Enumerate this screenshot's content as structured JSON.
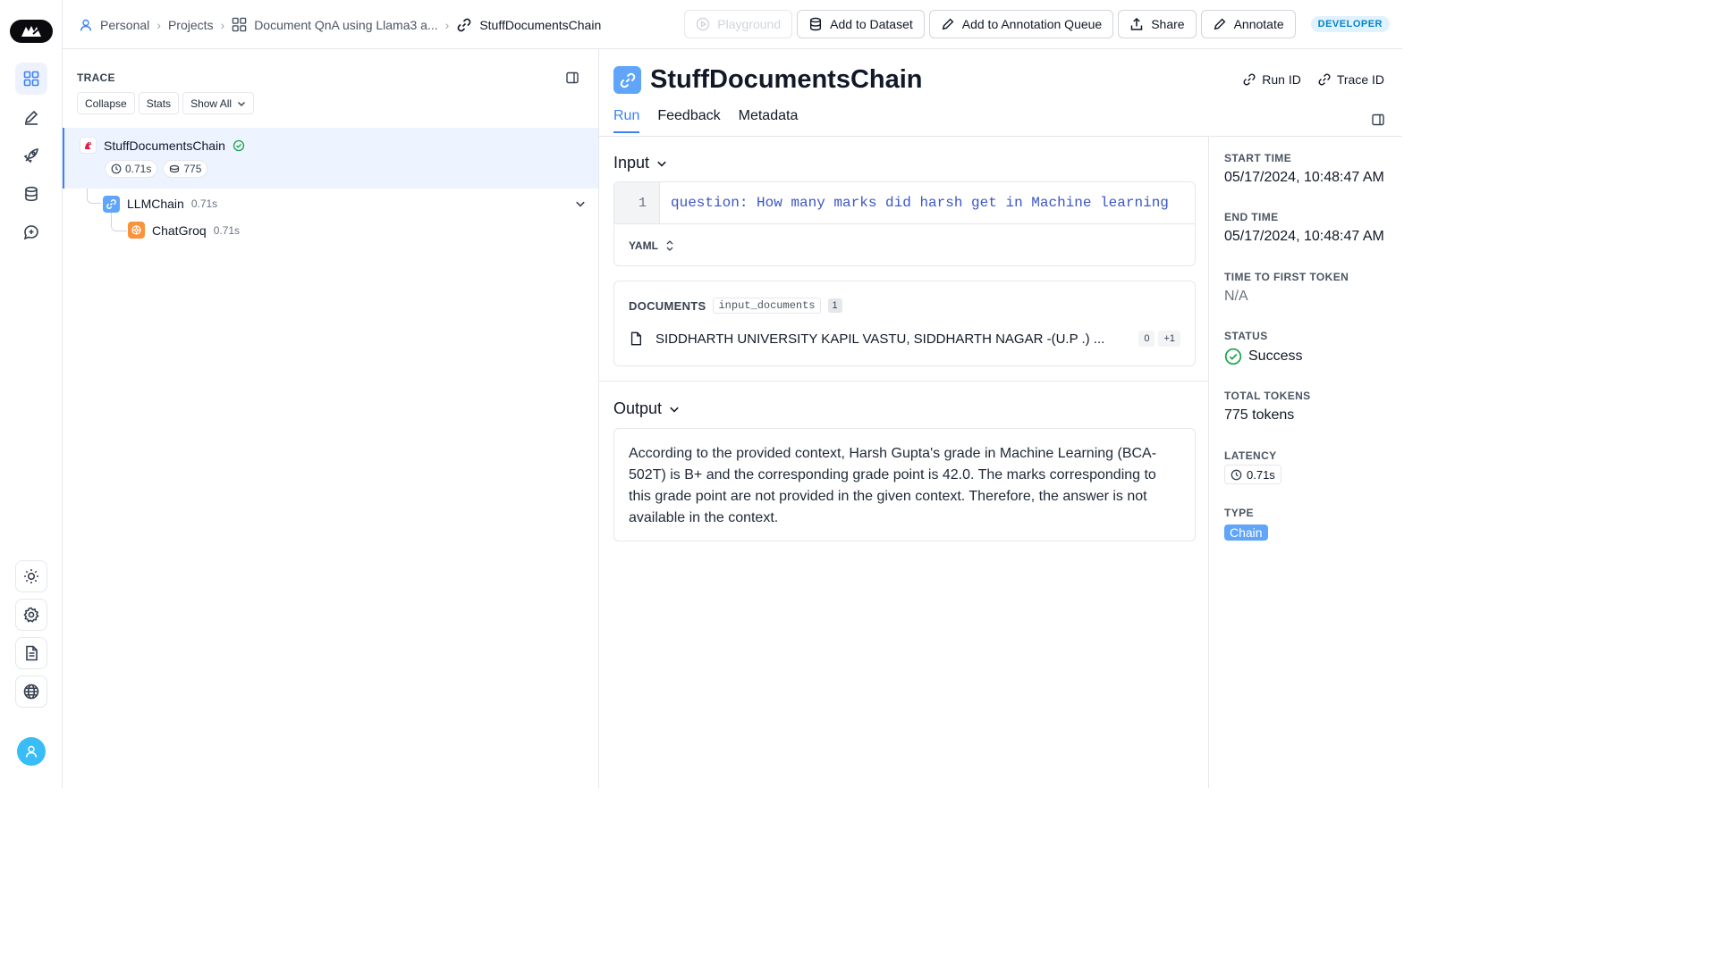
{
  "breadcrumb": {
    "items": [
      "Personal",
      "Projects",
      "Document QnA using Llama3 a...",
      "StuffDocumentsChain"
    ]
  },
  "toolbar": {
    "playground": "Playground",
    "add_dataset": "Add to Dataset",
    "add_annotation_queue": "Add to Annotation Queue",
    "share": "Share",
    "annotate": "Annotate",
    "plan_badge": "DEVELOPER"
  },
  "trace": {
    "title": "TRACE",
    "collapse": "Collapse",
    "stats": "Stats",
    "show_all": "Show All",
    "root": {
      "name": "StuffDocumentsChain",
      "latency": "0.71s",
      "tokens": "775"
    },
    "children": [
      {
        "name": "LLMChain",
        "latency": "0.71s"
      },
      {
        "name": "ChatGroq",
        "latency": "0.71s"
      }
    ]
  },
  "run": {
    "title": "StuffDocumentsChain",
    "run_id_label": "Run ID",
    "trace_id_label": "Trace ID",
    "tabs": [
      "Run",
      "Feedback",
      "Metadata"
    ],
    "input_heading": "Input",
    "input_line_no": "1",
    "input_code": "question: How many marks did harsh get in Machine learning",
    "format": "YAML",
    "documents_label": "DOCUMENTS",
    "documents_key": "input_documents",
    "documents_count": "1",
    "document_text": "SIDDHARTH UNIVERSITY KAPIL VASTU, SIDDHARTH NAGAR -(U.P .) ...",
    "document_index": "0",
    "document_more": "+1",
    "output_heading": "Output",
    "output_text": "According to the provided context, Harsh Gupta's grade in Machine Learning (BCA-502T) is B+ and the corresponding grade point is 42.0. The marks corresponding to this grade point are not provided in the given context. Therefore, the answer is not available in the context."
  },
  "meta": {
    "start_time_label": "START TIME",
    "start_time": "05/17/2024, 10:48:47 AM",
    "end_time_label": "END TIME",
    "end_time": "05/17/2024, 10:48:47 AM",
    "ttft_label": "TIME TO FIRST TOKEN",
    "ttft": "N/A",
    "status_label": "STATUS",
    "status": "Success",
    "tokens_label": "TOTAL TOKENS",
    "tokens": "775 tokens",
    "latency_label": "LATENCY",
    "latency": "0.71s",
    "type_label": "TYPE",
    "type": "Chain"
  },
  "colors": {
    "accent": "#3b82f6",
    "success": "#16a34a",
    "chatgroq": "#f97316"
  }
}
